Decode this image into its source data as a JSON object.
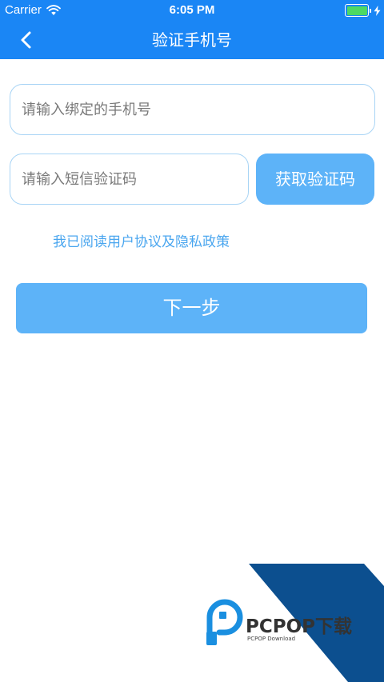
{
  "status_bar": {
    "carrier": "Carrier",
    "time": "6:05 PM",
    "battery_level": 1.0
  },
  "nav": {
    "title": "验证手机号",
    "back_icon": "chevron-left-icon"
  },
  "form": {
    "phone_placeholder": "请输入绑定的手机号",
    "code_placeholder": "请输入短信验证码",
    "get_code_label": "获取验证码",
    "agreement_text": "我已阅读用户协议及隐私政策",
    "next_label": "下一步"
  },
  "watermark": {
    "brand": "PCPOP下载",
    "sub": "PCPOP Download"
  },
  "colors": {
    "header": "#1a86f5",
    "button": "#5db3f8",
    "field_border": "#a8d4f5",
    "link": "#4aa6ef",
    "watermark_band": "#0c4f8f"
  }
}
